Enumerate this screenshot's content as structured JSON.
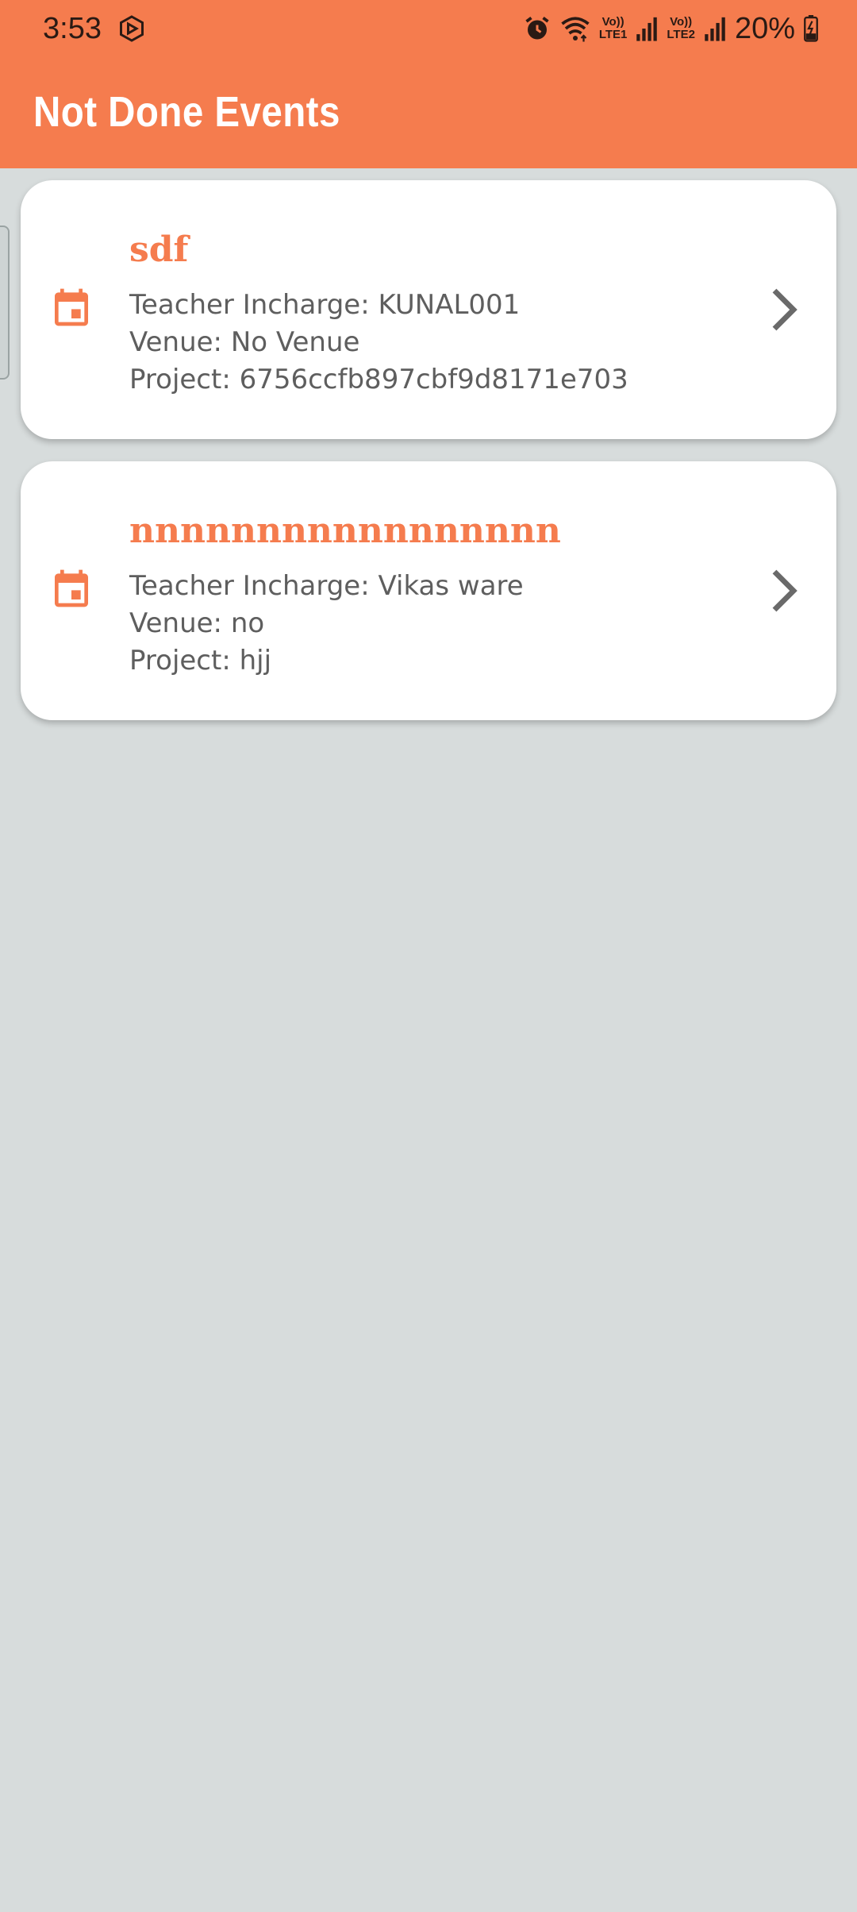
{
  "status_bar": {
    "time": "3:53",
    "volte1": "Vo))",
    "lte1": "LTE1",
    "volte2": "Vo))",
    "lte2": "LTE2",
    "battery": "20%"
  },
  "header": {
    "title": "Not Done Events"
  },
  "events": [
    {
      "title": "sdf",
      "teacher": "Teacher Incharge: KUNAL001",
      "venue": "Venue: No Venue",
      "project": "Project: 6756ccfb897cbf9d8171e703",
      "icon": "calendar-icon"
    },
    {
      "title": "nnnnnnnnnnnnnnnnn",
      "teacher": "Teacher Incharge: Vikas ware",
      "venue": "Venue: no",
      "project": "Project: hjj",
      "icon": "calendar-icon"
    }
  ],
  "colors": {
    "accent": "#F57C4E",
    "background": "#D7DCDC",
    "card": "#FFFFFF",
    "secondary_text": "#5E5E5E",
    "chevron": "#6A6A6A"
  }
}
